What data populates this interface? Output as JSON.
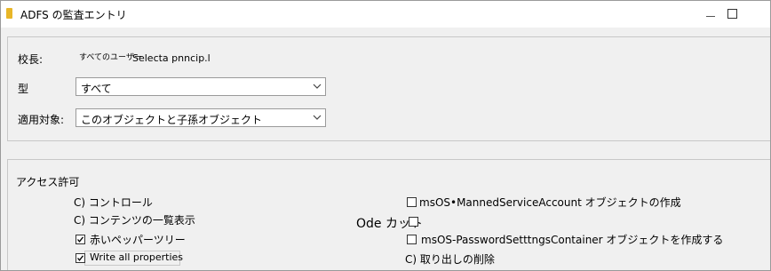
{
  "window": {
    "title": "ADFS の監査エントリ"
  },
  "principal": {
    "label": "校長:",
    "value_prefix": "すべてのユーザー",
    "value": "Selecta pnncip.l"
  },
  "type_field": {
    "label": "型",
    "selected": "すべて"
  },
  "applies_to": {
    "label": "適用対象:",
    "selected": "このオブジェクトと子孫オブジェクト"
  },
  "permissions": {
    "header": "アクセス許可",
    "left": [
      {
        "label": "C) コントロール",
        "checked": null
      },
      {
        "label": "C) コンテンツの一覧表示",
        "checked": null
      },
      {
        "label": "赤いペッパーツリー",
        "checked": true
      },
      {
        "label": "Write all properties",
        "checked": true
      }
    ],
    "right": [
      {
        "label": "msOS•MannedServiceAccount オブジェクトの作成",
        "checked": false
      },
      {
        "label": "Ode カット",
        "checked": false
      },
      {
        "label": "msOS-PasswordSetttngsContainer オブジェクトを作成する",
        "checked": false
      },
      {
        "label": "C) 取り出しの削除",
        "checked": null
      }
    ]
  }
}
